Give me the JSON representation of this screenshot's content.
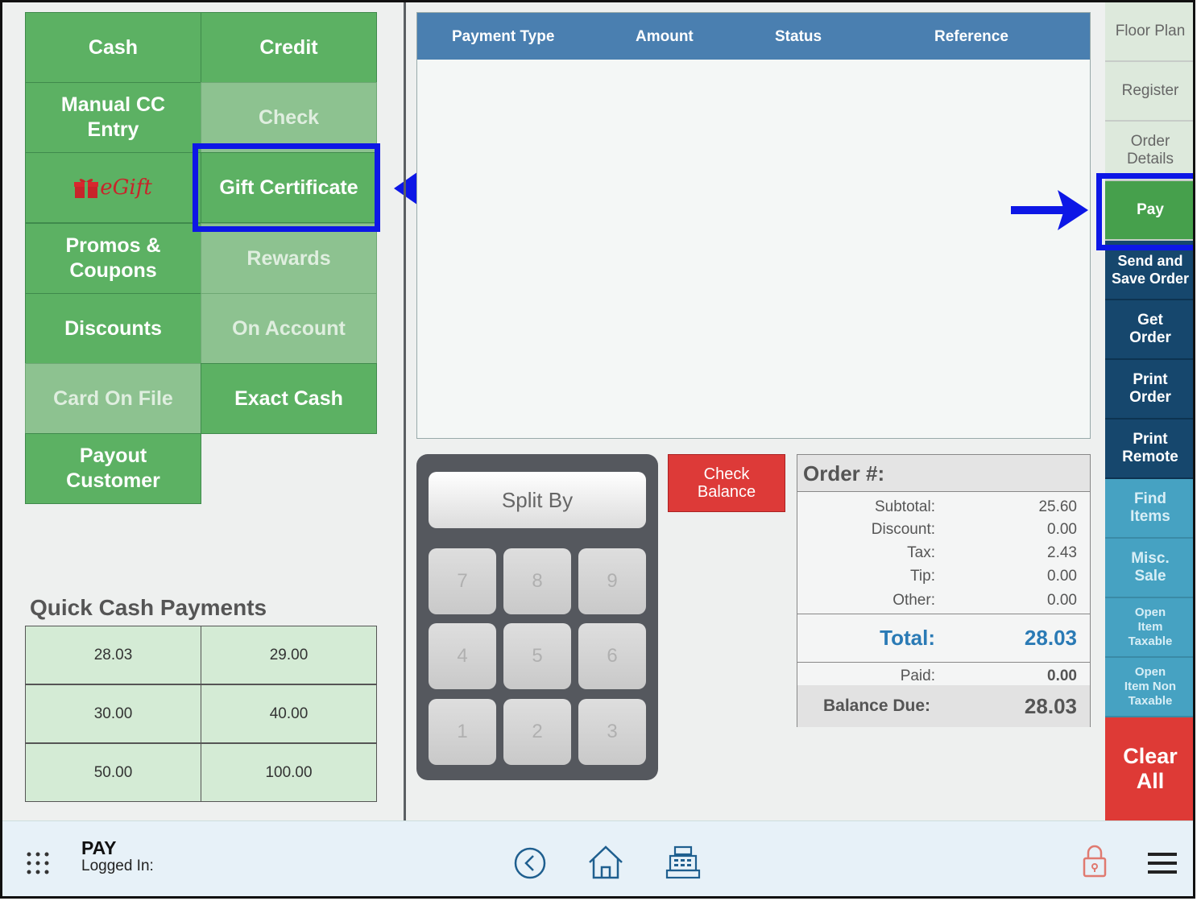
{
  "payment_buttons": [
    {
      "label": "Cash",
      "enabled": true
    },
    {
      "label": "Credit",
      "enabled": true
    },
    {
      "label": "Manual CC Entry",
      "enabled": true
    },
    {
      "label": "Check",
      "enabled": false
    },
    {
      "label": "eGift",
      "enabled": true
    },
    {
      "label": "Gift Certificate",
      "enabled": true
    },
    {
      "label": "Promos & Coupons",
      "enabled": true
    },
    {
      "label": "Rewards",
      "enabled": false
    },
    {
      "label": "Discounts",
      "enabled": true
    },
    {
      "label": "On Account",
      "enabled": false
    },
    {
      "label": "Card On File",
      "enabled": false
    },
    {
      "label": "Exact Cash",
      "enabled": true
    },
    {
      "label": "Payout Customer",
      "enabled": true
    }
  ],
  "quick_cash": {
    "title": "Quick Cash Payments",
    "amounts": [
      "28.03",
      "29.00",
      "30.00",
      "40.00",
      "50.00",
      "100.00"
    ]
  },
  "payments_table": {
    "columns": [
      "Payment Type",
      "Amount",
      "Status",
      "Reference"
    ]
  },
  "keypad": {
    "split_label": "Split By",
    "keys": [
      "7",
      "8",
      "9",
      "4",
      "5",
      "6",
      "1",
      "2",
      "3"
    ]
  },
  "check_balance_label": "Check Balance",
  "order_summary": {
    "title": "Order #:",
    "subtotal_label": "Subtotal:",
    "subtotal": "25.60",
    "discount_label": "Discount:",
    "discount": "0.00",
    "tax_label": "Tax:",
    "tax": "2.43",
    "tip_label": "Tip:",
    "tip": "0.00",
    "other_label": "Other:",
    "other": "0.00",
    "total_label": "Total:",
    "total": "28.03",
    "paid_label": "Paid:",
    "paid": "0.00",
    "balance_label": "Balance Due:",
    "balance": "28.03"
  },
  "right_nav": {
    "floor_plan": "Floor Plan",
    "register": "Register",
    "order_details": "Order Details",
    "pay": "Pay",
    "send_save": "Send and Save Order",
    "get_order": "Get Order",
    "print_order": "Print Order",
    "print_remote": "Print Remote",
    "find_items": "Find Items",
    "misc_sale": "Misc. Sale",
    "open_taxable": "Open Item Taxable",
    "open_non_taxable": "Open Item Non Taxable",
    "clear_all": "Clear All"
  },
  "bottom_bar": {
    "screen_name": "PAY",
    "logged_in_label": "Logged In:"
  },
  "colors": {
    "payment_green": "#5cb163",
    "header_blue": "#4a7fb0",
    "nav_dark": "#16476d",
    "nav_teal": "#46a2c2",
    "alert_red": "#de3a36",
    "highlight_blue": "#0d17e6"
  },
  "icons": [
    "egift-logo",
    "apps-grid-icon",
    "back-circle-icon",
    "home-icon",
    "register-icon",
    "lock-icon",
    "menu-icon",
    "arrow-left-icon",
    "arrow-right-icon"
  ]
}
